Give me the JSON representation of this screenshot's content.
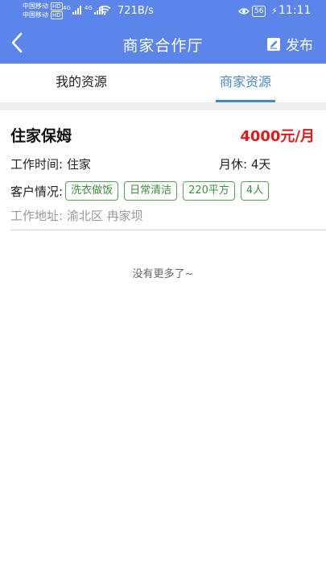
{
  "status_bar": {
    "carrier_1": "中国移动",
    "carrier_2": "中国移动",
    "hd_label": "HD",
    "network_1": "4G",
    "network_2": "4G",
    "net_speed": "721B/s",
    "battery": "56",
    "time": "11:11"
  },
  "header": {
    "title": "商家合作厅",
    "publish_label": "发布"
  },
  "tabs": [
    {
      "label": "我的资源",
      "active": false
    },
    {
      "label": "商家资源",
      "active": true
    }
  ],
  "listing": {
    "title": "住家保姆",
    "salary": "4000元/月",
    "work_time_label": "工作时间:",
    "work_time_value": "住家",
    "rest_label": "月休:",
    "rest_value": "4天",
    "customer_label": "客户情况:",
    "tags": [
      "洗衣做饭",
      "日常清洁",
      "220平方",
      "4人"
    ],
    "address_label": "工作地址:",
    "address_value": "渝北区 冉家坝"
  },
  "footer_text": "没有更多了~",
  "colors": {
    "header_bg": "#5b85e8",
    "active_tab": "#4a86c8",
    "salary": "#e11919",
    "tag_border": "#53a553"
  }
}
